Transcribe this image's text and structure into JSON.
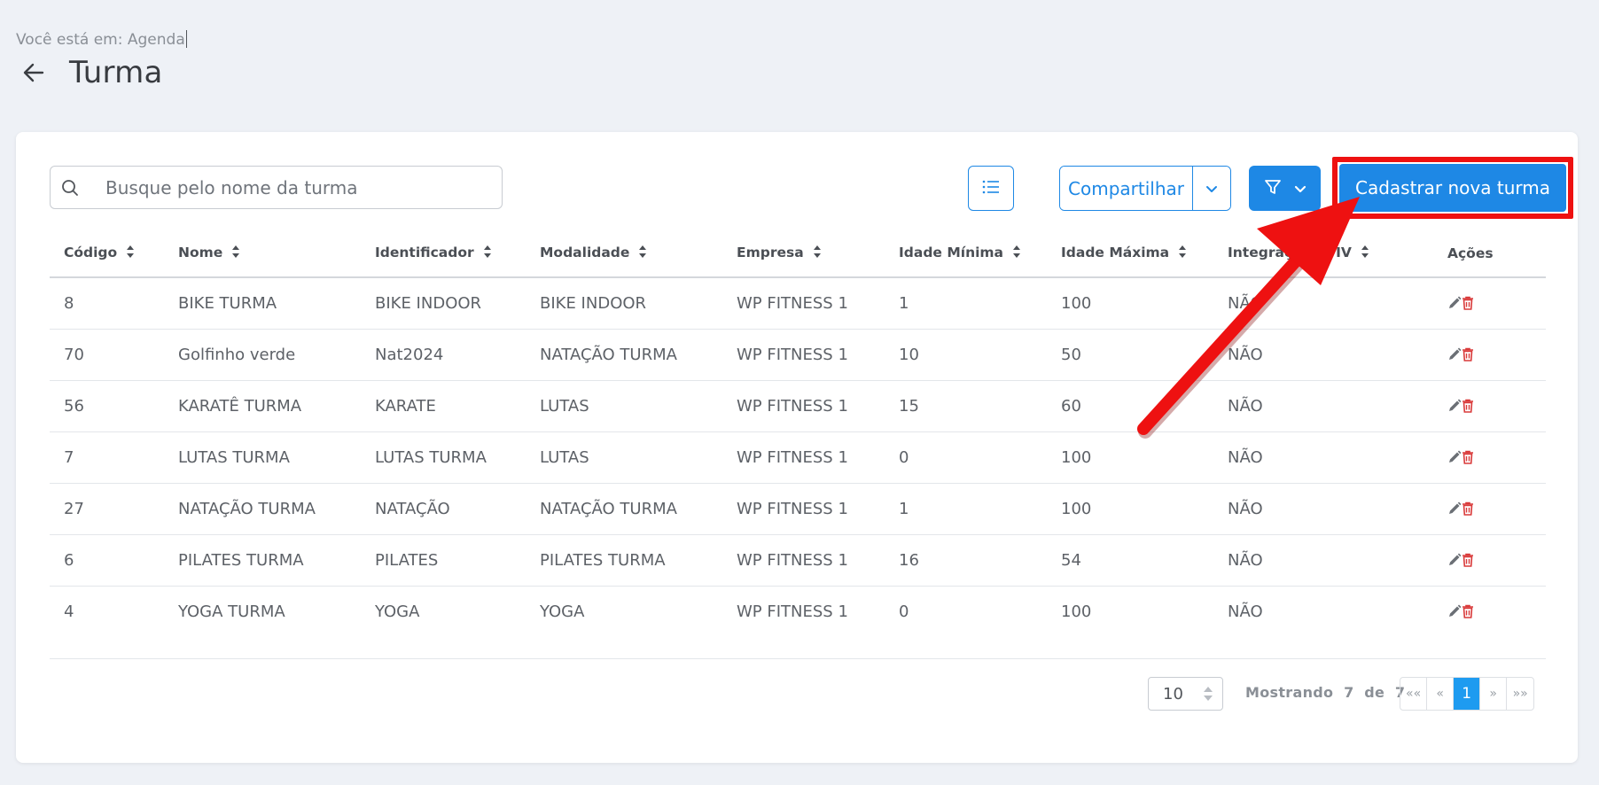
{
  "breadcrumb": {
    "prefix": "Você está em:",
    "current": "Agenda"
  },
  "page": {
    "title": "Turma"
  },
  "search": {
    "placeholder": "Busque pelo nome da turma"
  },
  "toolbar": {
    "share_label": "Compartilhar",
    "new_label": "Cadastrar nova turma"
  },
  "table": {
    "headers": [
      "Código",
      "Nome",
      "Identificador",
      "Modalidade",
      "Empresa",
      "Idade Mínima",
      "Idade Máxima",
      "Integração SPIV",
      "Ações"
    ],
    "header_integracao_visible": "Integração",
    "header_integracao_tail": "SPIV",
    "rows": [
      [
        "8",
        "BIKE TURMA",
        "BIKE INDOOR",
        "BIKE INDOOR",
        "WP FITNESS 1",
        "1",
        "100",
        "NÃO"
      ],
      [
        "70",
        "Golfinho verde",
        "Nat2024",
        "NATAÇÃO TURMA",
        "WP FITNESS 1",
        "10",
        "50",
        "NÃO"
      ],
      [
        "56",
        "KARATÊ TURMA",
        "KARATE",
        "LUTAS",
        "WP FITNESS 1",
        "15",
        "60",
        "NÃO"
      ],
      [
        "7",
        "LUTAS TURMA",
        "LUTAS TURMA",
        "LUTAS",
        "WP FITNESS 1",
        "0",
        "100",
        "NÃO"
      ],
      [
        "27",
        "NATAÇÃO TURMA",
        "NATAÇÃO",
        "NATAÇÃO TURMA",
        "WP FITNESS 1",
        "1",
        "100",
        "NÃO"
      ],
      [
        "6",
        "PILATES TURMA",
        "PILATES",
        "PILATES TURMA",
        "WP FITNESS 1",
        "16",
        "54",
        "NÃO"
      ],
      [
        "4",
        "YOGA TURMA",
        "YOGA",
        "YOGA",
        "WP FITNESS 1",
        "0",
        "100",
        "NÃO"
      ]
    ]
  },
  "pagination": {
    "page_size": "10",
    "showing_label": "Mostrando",
    "showing_count": "7",
    "of_label": "de",
    "total": "7",
    "first": "««",
    "prev": "«",
    "current": "1",
    "next": "»",
    "last": "»»"
  },
  "colors": {
    "primary": "#1e88e5",
    "annotation": "#ee1111",
    "delete": "#d93a3a",
    "edit": "#6b6f75"
  }
}
